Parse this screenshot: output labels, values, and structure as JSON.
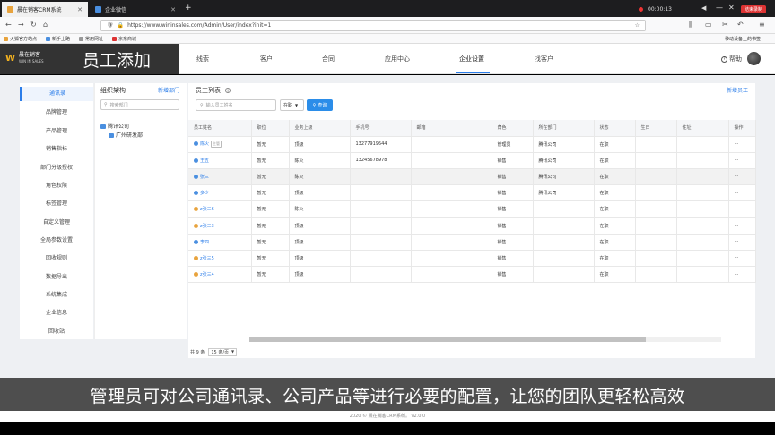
{
  "browser": {
    "tabs": [
      {
        "title": "晨在销客CRM系统"
      },
      {
        "title": "企业微信"
      }
    ],
    "new_tab": "+",
    "recording_time": "00:00:13",
    "recording_end": "结束录制",
    "url": "https://www.wininsales.com/Admin/User/index?init=1",
    "bookmarks": [
      "火狐官方站点",
      "新手上路",
      "常用网址",
      "京东商城"
    ],
    "mobile_bookmarks": "移动设备上的书签"
  },
  "header": {
    "logo_mark": "W",
    "logo_text_line1": "晨在销客",
    "logo_text_line2": "WIN IN SALES",
    "video_title": "员工添加",
    "nav": [
      "线索",
      "客户",
      "合同",
      "应用中心",
      "企业设置",
      "找客户"
    ],
    "active_nav": "企业设置",
    "help": "帮助"
  },
  "left_menu": {
    "items": [
      "通讯录",
      "品牌管理",
      "产品管理",
      "销售指标",
      "部门分级授权",
      "角色权限",
      "标签管理",
      "自定义管理",
      "全局参数设置",
      "回收规则",
      "数据导出",
      "系统集成",
      "企业信息",
      "回收站"
    ],
    "active": "通讯录"
  },
  "org": {
    "title": "组织架构",
    "new_dept": "新增部门",
    "search_placeholder": "搜索部门",
    "tree_root": "腾讯公司",
    "tree_child": "广州研发部"
  },
  "employees": {
    "title": "员工列表",
    "new_button": "新增员工",
    "search_placeholder": "输入员工姓名",
    "status_filter": "在职",
    "query_button": "查询",
    "columns": [
      "员工姓名",
      "职位",
      "业务上级",
      "手机号",
      "邮箱",
      "角色",
      "所在部门",
      "状态",
      "生日",
      "住址",
      "操作"
    ],
    "rows": [
      {
        "name": "陈火",
        "badge": "主管",
        "icon": "blue",
        "position": "暂无",
        "superior": "顶级",
        "phone": "13277919544",
        "email": "",
        "role": "管理员",
        "dept": "腾讯公司",
        "status": "在职",
        "birthday": "",
        "address": "",
        "op": "···"
      },
      {
        "name": "王五",
        "badge": "",
        "icon": "blue",
        "position": "暂无",
        "superior": "陈火",
        "phone": "13245678978",
        "email": "",
        "role": "销售",
        "dept": "腾讯公司",
        "status": "在职",
        "birthday": "",
        "address": "",
        "op": "···"
      },
      {
        "name": "张三",
        "badge": "",
        "icon": "blue",
        "position": "暂无",
        "superior": "陈火",
        "phone": "",
        "email": "",
        "role": "销售",
        "dept": "腾讯公司",
        "status": "在职",
        "birthday": "",
        "address": "",
        "op": "···"
      },
      {
        "name": "多少",
        "badge": "",
        "icon": "blue",
        "position": "暂无",
        "superior": "顶级",
        "phone": "",
        "email": "",
        "role": "销售",
        "dept": "腾讯公司",
        "status": "在职",
        "birthday": "",
        "address": "",
        "op": "···"
      },
      {
        "name": "z张三6",
        "badge": "",
        "icon": "orange",
        "position": "暂无",
        "superior": "陈火",
        "phone": "",
        "email": "",
        "role": "销售",
        "dept": "",
        "status": "在职",
        "birthday": "",
        "address": "",
        "op": "···"
      },
      {
        "name": "z张三3",
        "badge": "",
        "icon": "orange",
        "position": "暂无",
        "superior": "顶级",
        "phone": "",
        "email": "",
        "role": "销售",
        "dept": "",
        "status": "在职",
        "birthday": "",
        "address": "",
        "op": "···"
      },
      {
        "name": "李四",
        "badge": "",
        "icon": "blue",
        "position": "暂无",
        "superior": "顶级",
        "phone": "",
        "email": "",
        "role": "销售",
        "dept": "",
        "status": "在职",
        "birthday": "",
        "address": "",
        "op": "···"
      },
      {
        "name": "z张三5",
        "badge": "",
        "icon": "orange",
        "position": "暂无",
        "superior": "顶级",
        "phone": "",
        "email": "",
        "role": "销售",
        "dept": "",
        "status": "在职",
        "birthday": "",
        "address": "",
        "op": "···"
      },
      {
        "name": "z张三4",
        "badge": "",
        "icon": "orange",
        "position": "暂无",
        "superior": "顶级",
        "phone": "",
        "email": "",
        "role": "销售",
        "dept": "",
        "status": "在职",
        "birthday": "",
        "address": "",
        "op": "···"
      }
    ],
    "total": "共 9 条",
    "page_size": "15 条/页"
  },
  "subtitle": "管理员可对公司通讯录、公司产品等进行必要的配置，让您的团队更轻松高效",
  "footer": "2020 © 晨在销客CRM系统。 v2.0.0",
  "colors": {
    "accent": "#2b7de9",
    "header_bg": "#333333",
    "subtitle_bg": "#4e4e4e"
  }
}
